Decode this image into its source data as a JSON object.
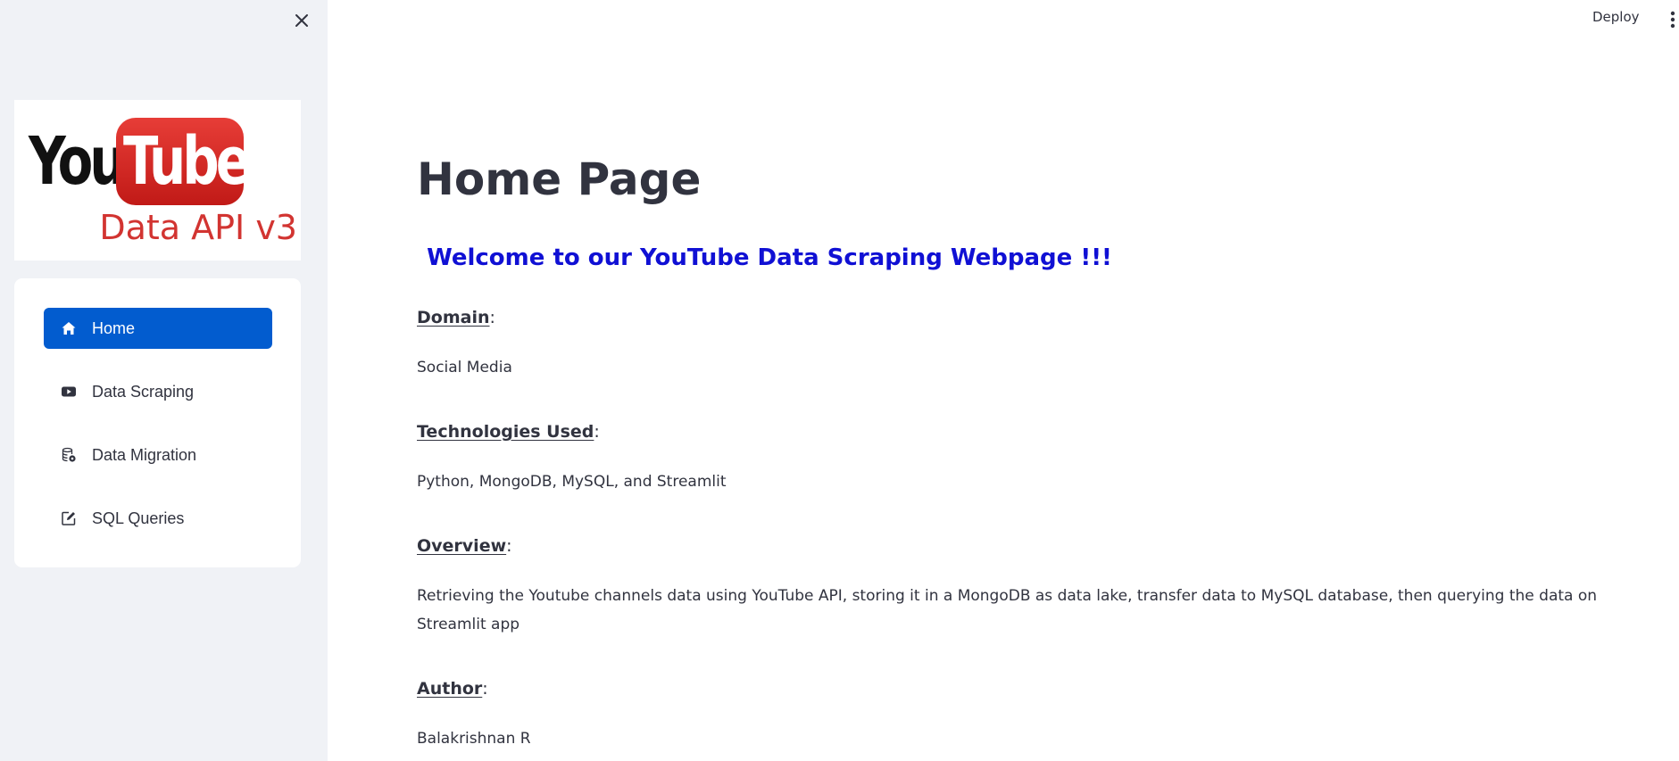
{
  "sidebar": {
    "logo": {
      "word_you": "You",
      "word_tube": "Tube",
      "subtitle": "Data API v3",
      "colors": {
        "tube_red": "#e02a26",
        "subtitle_red": "#d23431"
      }
    },
    "nav": [
      {
        "label": "Home",
        "icon": "home-icon",
        "active": true
      },
      {
        "label": "Data Scraping",
        "icon": "youtube-icon",
        "active": false
      },
      {
        "label": "Data Migration",
        "icon": "database-icon",
        "active": false
      },
      {
        "label": "SQL Queries",
        "icon": "edit-icon",
        "active": false
      }
    ],
    "close_icon": "close-icon"
  },
  "header": {
    "deploy_label": "Deploy",
    "menu_icon": "kebab-menu-icon"
  },
  "main": {
    "title": "Home Page",
    "welcome": "Welcome to our YouTube Data Scraping Webpage !!!",
    "sections": [
      {
        "heading": "Domain",
        "text": "Social Media"
      },
      {
        "heading": "Technologies Used",
        "text": "Python, MongoDB, MySQL, and Streamlit"
      },
      {
        "heading": "Overview",
        "text": "Retrieving the Youtube channels data using YouTube API, storing it in a MongoDB as data lake, transfer data to MySQL database, then querying the data on Streamlit app"
      },
      {
        "heading": "Author",
        "text": "Balakrishnan R"
      }
    ]
  },
  "colors": {
    "sidebar_bg": "#f0f2f6",
    "active_nav": "#025ccf",
    "welcome_text": "#1010d4",
    "body_text": "#31333f"
  }
}
